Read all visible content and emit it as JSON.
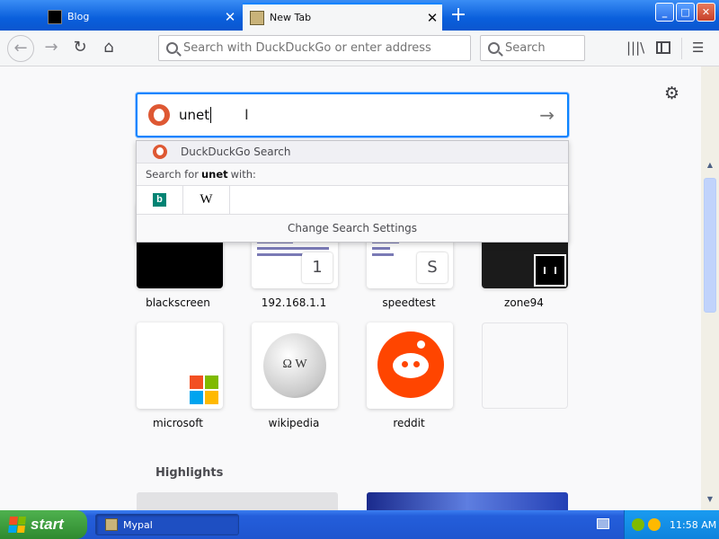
{
  "tabs": [
    {
      "title": "Blog",
      "active": false
    },
    {
      "title": "New Tab",
      "active": true
    }
  ],
  "window_controls": {
    "minimize": "_",
    "maximize": "□",
    "close": "✕"
  },
  "navbar": {
    "url_placeholder": "Search with DuckDuckGo or enter address",
    "search_placeholder": "Search"
  },
  "newtab_search": {
    "typed_text": "unet",
    "engine_row_label": "DuckDuckGo Search",
    "search_for_prefix": "Search for",
    "search_for_term": "unet",
    "search_for_suffix": "with:",
    "engines": [
      "bing-icon",
      "wikipedia-icon"
    ],
    "change_settings": "Change Search Settings"
  },
  "top_sites": [
    {
      "label": "blackscreen"
    },
    {
      "label": "192.168.1.1",
      "badge": "1"
    },
    {
      "label": "speedtest",
      "badge": "S"
    },
    {
      "label": "zone94"
    },
    {
      "label": "microsoft"
    },
    {
      "label": "wikipedia"
    },
    {
      "label": "reddit"
    },
    {
      "label": ""
    }
  ],
  "highlights_title": "Highlights",
  "taskbar": {
    "start_label": "start",
    "task_label": "Mypal",
    "clock": "11:58 AM"
  },
  "colors": {
    "accent": "#0a84ff",
    "ddg": "#de5833",
    "reddit": "#ff4500",
    "xp_blue": "#245edb",
    "xp_green": "#3c9a3c"
  }
}
